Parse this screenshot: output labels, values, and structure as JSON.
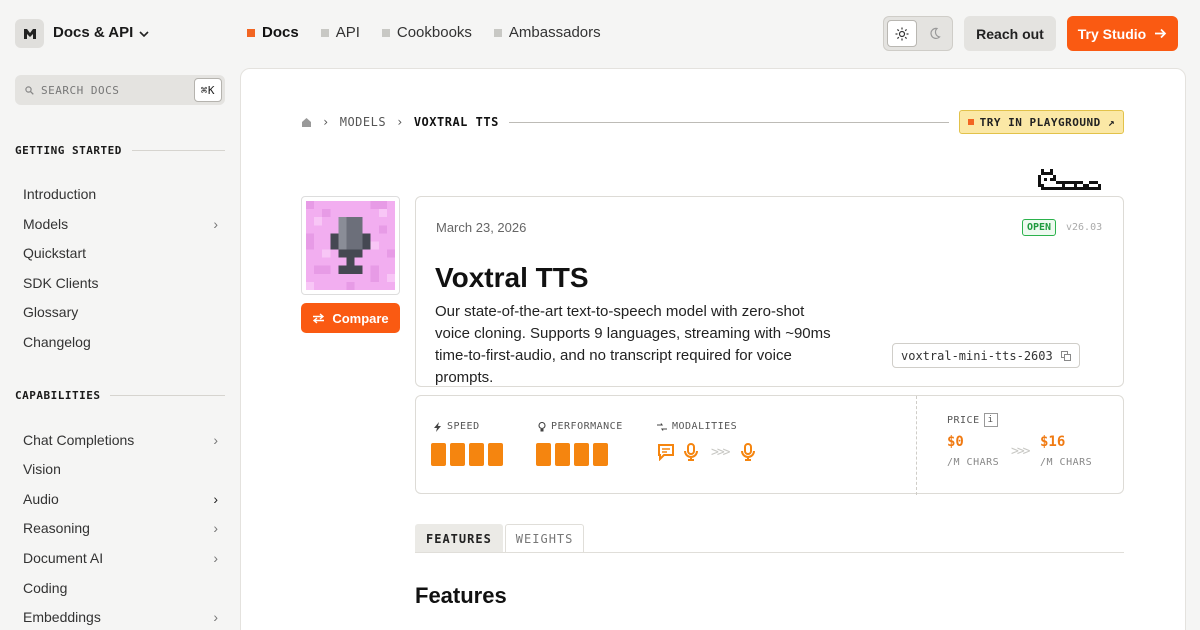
{
  "header": {
    "brand": "Docs & API",
    "nav": [
      {
        "label": "Docs",
        "active": true
      },
      {
        "label": "API",
        "active": false
      },
      {
        "label": "Cookbooks",
        "active": false
      },
      {
        "label": "Ambassadors",
        "active": false
      }
    ],
    "reach_out": "Reach out",
    "try_studio": "Try Studio"
  },
  "sidebar": {
    "search_placeholder": "SEARCH DOCS",
    "search_shortcut": "⌘K",
    "sections": [
      {
        "title": "GETTING STARTED",
        "items": [
          {
            "label": "Introduction",
            "chevron": false
          },
          {
            "label": "Models",
            "chevron": true
          },
          {
            "label": "Quickstart",
            "chevron": false
          },
          {
            "label": "SDK Clients",
            "chevron": false
          },
          {
            "label": "Glossary",
            "chevron": false
          },
          {
            "label": "Changelog",
            "chevron": false
          }
        ]
      },
      {
        "title": "CAPABILITIES",
        "items": [
          {
            "label": "Chat Completions",
            "chevron": true
          },
          {
            "label": "Vision",
            "chevron": false
          },
          {
            "label": "Audio",
            "chevron": true
          },
          {
            "label": "Reasoning",
            "chevron": true
          },
          {
            "label": "Document AI",
            "chevron": true
          },
          {
            "label": "Coding",
            "chevron": false
          },
          {
            "label": "Embeddings",
            "chevron": true
          }
        ]
      }
    ]
  },
  "breadcrumb": {
    "section": "MODELS",
    "current": "VOXTRAL TTS",
    "playground": "TRY IN PLAYGROUND ↗"
  },
  "model": {
    "compare": "Compare",
    "date": "March 23, 2026",
    "status": "OPEN",
    "version": "v26.03",
    "name": "Voxtral TTS",
    "description": "Our state-of-the-art text-to-speech model with zero-shot voice cloning. Supports 9 languages, streaming with ~90ms time-to-first-audio, and no transcript required for voice prompts.",
    "model_id": "voxtral-mini-tts-2603"
  },
  "stats": {
    "speed_label": "SPEED",
    "speed_level": 4,
    "performance_label": "PERFORMANCE",
    "performance_level": 4,
    "modalities_label": "MODALITIES",
    "modalities_input": [
      "text-icon",
      "mic-icon"
    ],
    "modalities_output": [
      "mic-icon"
    ],
    "price_label": "PRICE",
    "price_info": "i",
    "input_price": "$0",
    "input_unit": "/M CHARS",
    "output_price": "$16",
    "output_unit": "/M CHARS"
  },
  "tabs": [
    "FEATURES",
    "WEIGHTS"
  ],
  "features_heading": "Features",
  "colors": {
    "accent": "#fa5a12",
    "bars": "#f5850f",
    "open": "#1f9a3d",
    "playground": "#fbe8a6"
  }
}
